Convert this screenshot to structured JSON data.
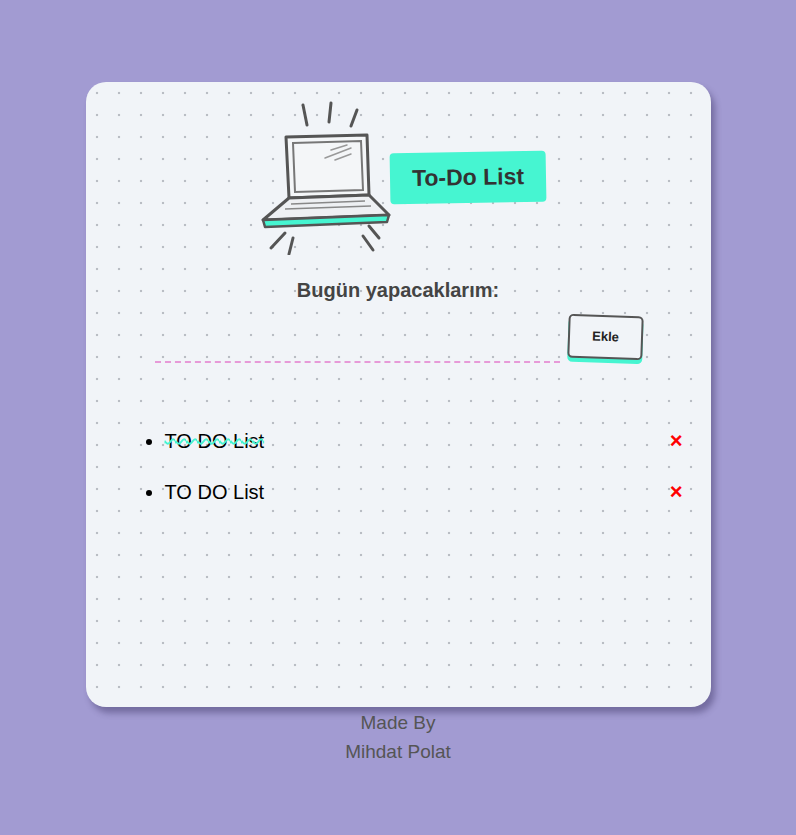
{
  "header": {
    "title": "To-Do List"
  },
  "prompt": "Bugün yapacaklarım:",
  "input": {
    "value": "",
    "placeholder": ""
  },
  "add_button": "Ekle",
  "items": [
    {
      "text": "TO DO List",
      "done": true,
      "delete": "×"
    },
    {
      "text": "TO DO List",
      "done": false,
      "delete": "×"
    }
  ],
  "footer": [
    "Made By",
    "Mihdat Polat"
  ]
}
